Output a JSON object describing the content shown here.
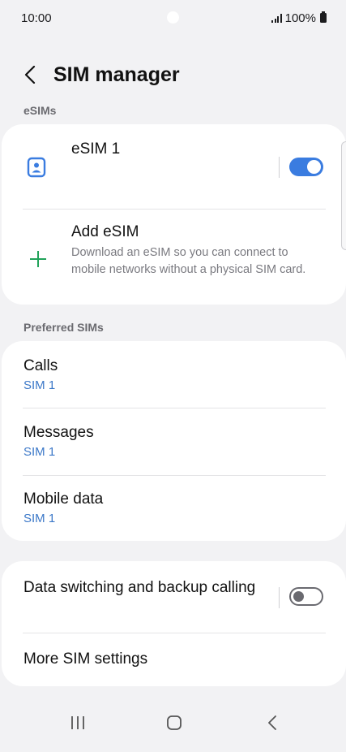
{
  "status_bar": {
    "time": "10:00",
    "battery": "100%",
    "icons": [
      "signal-icon",
      "battery-icon"
    ]
  },
  "header": {
    "title": "SIM manager",
    "back_icon": "chevron-left-icon"
  },
  "esims_section": {
    "label": "eSIMs",
    "esim": {
      "name": "eSIM 1",
      "icon": "sim-card-person-icon",
      "enabled": true
    },
    "add": {
      "title": "Add eSIM",
      "description": "Download an eSIM so you can connect to mobile networks without a physical SIM card.",
      "icon": "plus-icon"
    }
  },
  "preferred_section": {
    "label": "Preferred SIMs",
    "items": [
      {
        "title": "Calls",
        "value": "SIM 1"
      },
      {
        "title": "Messages",
        "value": "SIM 1"
      },
      {
        "title": "Mobile data",
        "value": "SIM 1"
      }
    ]
  },
  "other_section": {
    "data_switching": {
      "title": "Data switching and backup calling",
      "enabled": false
    },
    "more_settings": {
      "title": "More SIM settings"
    }
  },
  "nav_bar": {
    "icons": [
      "recents-icon",
      "home-icon",
      "back-icon"
    ]
  },
  "colors": {
    "accent": "#3a7ce0",
    "link": "#3c78c8",
    "add_icon": "#21a35a",
    "background": "#f2f2f4"
  }
}
